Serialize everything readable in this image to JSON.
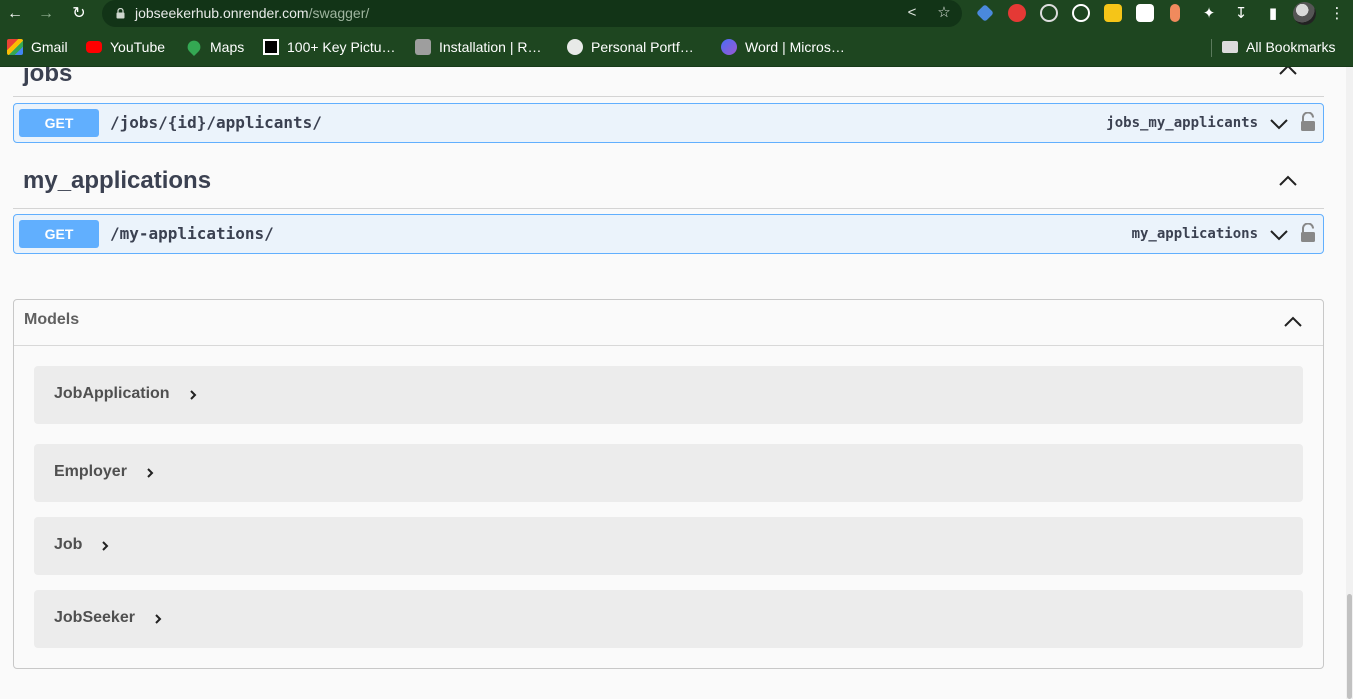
{
  "browser": {
    "url_host": "jobseekerhub.onrender.com",
    "url_path": "/swagger/",
    "bookmarks": [
      {
        "label": "Gmail",
        "icon": "gmail-icon"
      },
      {
        "label": "YouTube",
        "icon": "youtube-icon"
      },
      {
        "label": "Maps",
        "icon": "maps-icon"
      },
      {
        "label": "100+ Key Pictu…",
        "icon": "bookmark-favicon"
      },
      {
        "label": "Installation | R…",
        "icon": "bookmark-favicon"
      },
      {
        "label": "Personal Portf…",
        "icon": "globe-icon"
      },
      {
        "label": "Word | Micros…",
        "icon": "word-icon"
      }
    ],
    "all_bookmarks": "All Bookmarks"
  },
  "sections": [
    {
      "title": "jobs",
      "operations": [
        {
          "method": "GET",
          "path": "/jobs/{id}/applicants/",
          "operation_id": "jobs_my_applicants"
        }
      ]
    },
    {
      "title": "my_applications",
      "operations": [
        {
          "method": "GET",
          "path": "/my-applications/",
          "operation_id": "my_applications"
        }
      ]
    }
  ],
  "models": {
    "title": "Models",
    "items": [
      "JobApplication",
      "Employer",
      "Job",
      "JobSeeker"
    ]
  },
  "colors": {
    "chrome": "#1e4620",
    "get_method": "#61affe",
    "get_bg": "#ebf3fb"
  }
}
